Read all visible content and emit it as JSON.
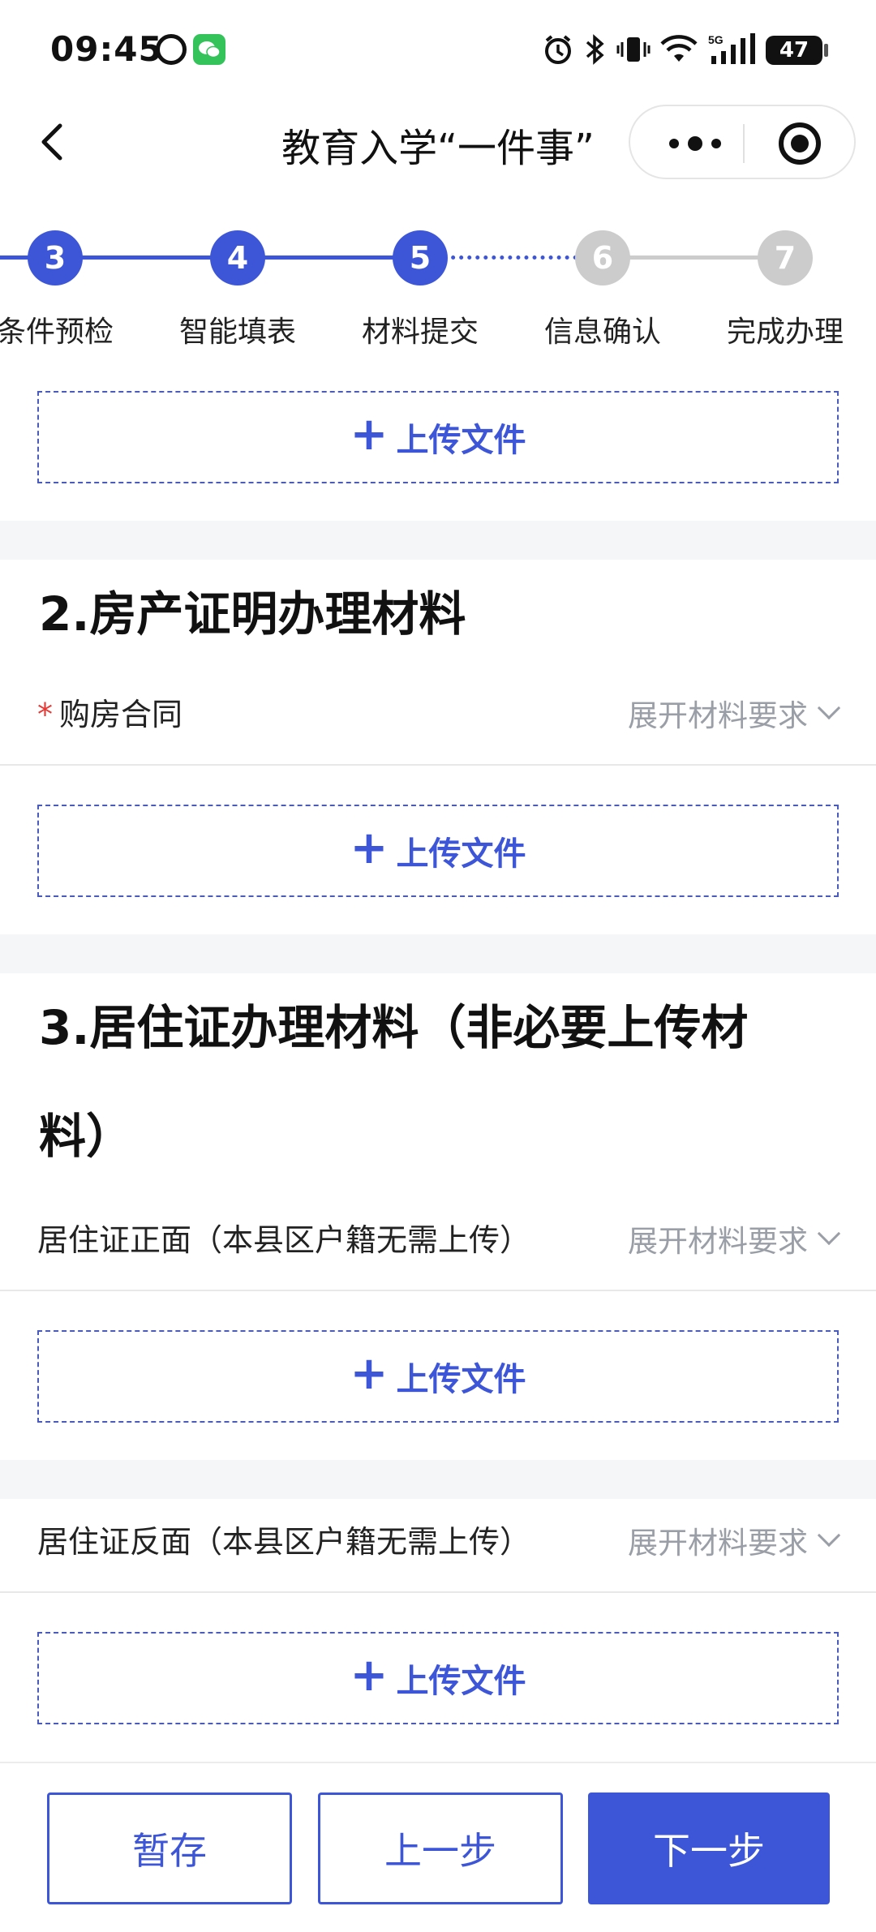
{
  "status_bar": {
    "time": "09:45",
    "battery": "47",
    "network": "5G"
  },
  "nav": {
    "title": "教育入学“一件事”"
  },
  "steps": [
    {
      "number": "3",
      "label": "条件预检",
      "state": "done"
    },
    {
      "number": "4",
      "label": "智能填表",
      "state": "done"
    },
    {
      "number": "5",
      "label": "材料提交",
      "state": "current"
    },
    {
      "number": "6",
      "label": "信息确认",
      "state": "pending"
    },
    {
      "number": "7",
      "label": "完成办理",
      "state": "pending"
    }
  ],
  "upload_label": "上传文件",
  "expand_label": "展开材料要求",
  "sections": [
    {
      "title": "2.房产证明办理材料",
      "items": [
        {
          "label": "购房合同",
          "required": true
        }
      ]
    },
    {
      "title_line1": "3.居住证办理材料（非必要上传材",
      "title_line2": "料）",
      "items": [
        {
          "label": "居住证正面（本县区户籍无需上传）",
          "required": false
        },
        {
          "label": "居住证反面（本县区户籍无需上传）",
          "required": false
        }
      ]
    }
  ],
  "buttons": {
    "save": "暂存",
    "prev": "上一步",
    "next": "下一步"
  },
  "colors": {
    "accent": "#3d56d8",
    "inactive": "#cccccc",
    "required": "#e53935"
  }
}
